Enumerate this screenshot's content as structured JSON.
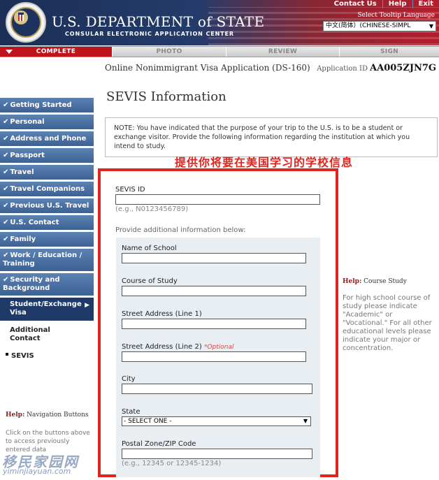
{
  "header": {
    "dept_title": "U.S. DEPARTMENT of STATE",
    "dept_subtitle": "CONSULAR ELECTRONIC APPLICATION CENTER",
    "links": [
      "Contact Us",
      "Help",
      "Exit"
    ],
    "tooltip_language_label": "Select Tooltip Language",
    "language_selected": "中文(简体）(CHINESE-SIMPL"
  },
  "progress": {
    "steps": [
      "COMPLETE",
      "PHOTO",
      "REVIEW",
      "SIGN"
    ],
    "current": "COMPLETE"
  },
  "app": {
    "title": "Online Nonimmigrant Visa Application (DS-160)",
    "id_label": "Application ID",
    "id_value": "AA005ZJN7G"
  },
  "page_title": "SEVIS Information",
  "sidebar": {
    "items": [
      "Getting Started",
      "Personal",
      "Address and Phone",
      "Passport",
      "Travel",
      "Travel Companions",
      "Previous U.S. Travel",
      "U.S. Contact",
      "Family",
      "Work / Education / Training",
      "Security and Background"
    ],
    "current": "Student/Exchange Visa",
    "subitems": [
      "Additional Contact",
      "SEVIS"
    ],
    "help_title_bold": "Help:",
    "help_title_rest": "Navigation Buttons",
    "help_text": "Click on the buttons above to access previously entered data"
  },
  "note": "NOTE: You have indicated that the purpose of your trip to the U.S. is to be a student or exchange visitor. Provide the following information regarding the institution at which you intend to study.",
  "annotation": "提供你将要在美国学习的学校信息",
  "form": {
    "sevis_label": "SEVIS ID",
    "sevis_value": "",
    "sevis_hint": "(e.g., N0123456789)",
    "additional_prompt": "Provide additional information below:",
    "school_label": "Name of School",
    "course_label": "Course of Study",
    "street1_label": "Street Address (Line 1)",
    "street2_label": "Street Address (Line 2)",
    "optional": "*Optional",
    "city_label": "City",
    "state_label": "State",
    "state_value": "- SELECT ONE -",
    "zip_label": "Postal Zone/ZIP Code",
    "zip_hint": "(e.g., 12345 or 12345-1234)"
  },
  "help_course": {
    "title_bold": "Help:",
    "title_rest": "Course Study",
    "text": "For high school course of study please indicate \"Academic\" or \"Vocational.\" For all other educational levels please indicate your major or concentration."
  },
  "watermark": {
    "text": "移民家园网",
    "url": "yiminjiayuan.com"
  },
  "colors": {
    "nav_blue": "#4a72a6",
    "nav_current": "#1f3a66",
    "progress_red": "#c0141c",
    "annotation_red": "#e0251f"
  }
}
